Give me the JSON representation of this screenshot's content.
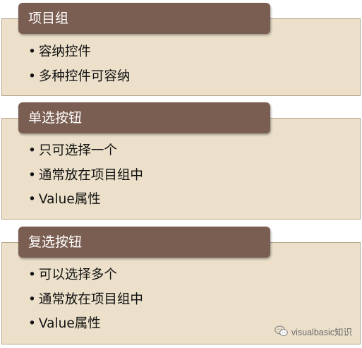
{
  "sections": [
    {
      "title": "项目组",
      "items": [
        "容纳控件",
        "多种控件可容纳"
      ]
    },
    {
      "title": "单选按钮",
      "items": [
        "只可选择一个",
        "通常放在项目组中",
        "Value属性"
      ]
    },
    {
      "title": "复选按钮",
      "items": [
        "可以选择多个",
        "通常放在项目组中",
        "Value属性"
      ]
    }
  ],
  "watermark": {
    "text": "visualbasic知识",
    "icon": "wechat-icon"
  },
  "colors": {
    "header": "#7b5e52",
    "body": "#ece0ca",
    "border": "#b8a58d"
  }
}
